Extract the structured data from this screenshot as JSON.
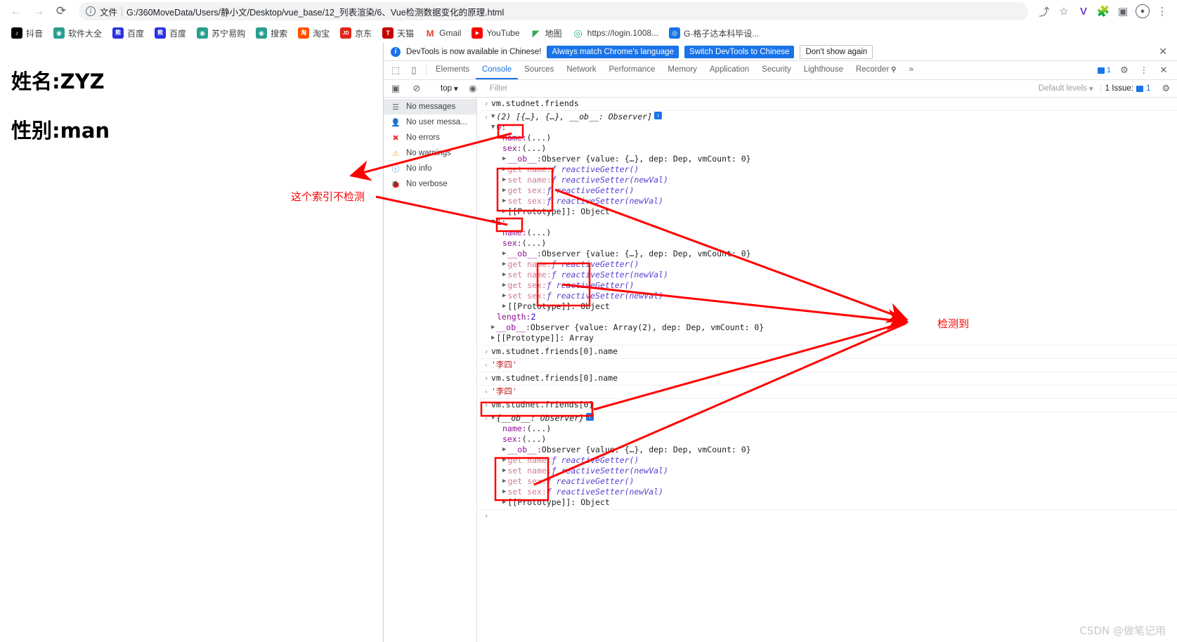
{
  "browser": {
    "nav": {
      "back": "←",
      "forward": "→",
      "reload": "⟳"
    },
    "omnibox": {
      "file_label": "文件",
      "url": "G:/360MoveData/Users/静小文/Desktop/vue_base/12_列表渲染/6、Vue检测数据变化的原理.html"
    },
    "toolbar_icons": [
      "share-icon",
      "bookmark-star-icon",
      "extension-v-icon",
      "extensions-puzzle-icon",
      "sidepanel-icon",
      "profile-avatar-icon",
      "chrome-menu-icon"
    ],
    "bookmarks": [
      {
        "label": "抖音",
        "glyph": "♪",
        "color": "#000000"
      },
      {
        "label": "软件大全",
        "glyph": "◉",
        "color": "#2a9d8f"
      },
      {
        "label": "百度",
        "glyph": "熊",
        "color": "#2932e1"
      },
      {
        "label": "百度",
        "glyph": "熊",
        "color": "#2932e1"
      },
      {
        "label": "苏宁易购",
        "glyph": "◉",
        "color": "#2a9d8f"
      },
      {
        "label": "搜索",
        "glyph": "◉",
        "color": "#2a9d8f"
      },
      {
        "label": "淘宝",
        "glyph": "淘",
        "color": "#ff5000"
      },
      {
        "label": "京东",
        "glyph": "JD",
        "color": "#e1251b"
      },
      {
        "label": "天猫",
        "glyph": "T",
        "color": "#c40000"
      },
      {
        "label": "Gmail",
        "glyph": "M",
        "color": "#ea4335"
      },
      {
        "label": "YouTube",
        "glyph": "▶",
        "color": "#ff0000"
      },
      {
        "label": "地图",
        "glyph": "◢",
        "color": "#34a853"
      },
      {
        "label": "https://login.1008...",
        "glyph": "◎",
        "color": "#2bb673"
      },
      {
        "label": "G·格子达本科毕设...",
        "glyph": "◎",
        "color": "#1a73e8"
      }
    ]
  },
  "page": {
    "line1": "姓名:ZYZ",
    "line2": "性别:man"
  },
  "devtools": {
    "banner": {
      "message": "DevTools is now available in Chinese!",
      "btn_always": "Always match Chrome's language",
      "btn_switch": "Switch DevTools to Chinese",
      "btn_dismiss": "Don't show again",
      "close": "✕"
    },
    "tabs": [
      {
        "label": "Elements",
        "active": false
      },
      {
        "label": "Console",
        "active": true
      },
      {
        "label": "Sources",
        "active": false
      },
      {
        "label": "Network",
        "active": false
      },
      {
        "label": "Performance",
        "active": false
      },
      {
        "label": "Memory",
        "active": false
      },
      {
        "label": "Application",
        "active": false
      },
      {
        "label": "Security",
        "active": false
      },
      {
        "label": "Lighthouse",
        "active": false
      },
      {
        "label": "Recorder",
        "active": false
      }
    ],
    "tabs_overflow": "»",
    "issues_count_tabbar": "1",
    "filterbar": {
      "context": "top",
      "filter_placeholder": "Filter",
      "levels": "Default levels",
      "issues_label": "1 Issue:",
      "issues_count": "1"
    },
    "sidebar": [
      {
        "label": "No messages",
        "icon": "list-icon",
        "selected": true
      },
      {
        "label": "No user messa...",
        "icon": "user-icon",
        "selected": false
      },
      {
        "label": "No errors",
        "icon": "error-icon",
        "selected": false
      },
      {
        "label": "No warnings",
        "icon": "warning-icon",
        "selected": false
      },
      {
        "label": "No info",
        "icon": "info-icon",
        "selected": false
      },
      {
        "label": "No verbose",
        "icon": "bug-icon",
        "selected": false
      }
    ],
    "console": {
      "input1": "vm.studnet.friends",
      "arr_header": "(2) [{…}, {…}, __ob__: Observer]",
      "idx0": "0:",
      "idx1": "1:",
      "name_prop": "name:",
      "sex_prop": "sex:",
      "ellipsis": "(...)",
      "ob_key": "__ob__:",
      "ob_val_obj": "Observer {value: {…}, dep: Dep, vmCount: 0}",
      "ob_val_arr": "Observer {value: Array(2), dep: Dep, vmCount: 0}",
      "get_name": "get name:",
      "set_name": "set name:",
      "get_sex": "get sex:",
      "set_sex": "set sex:",
      "reactive_getter": "ƒ reactiveGetter()",
      "reactive_setter": "ƒ reactiveSetter(newVal)",
      "proto_object": "[[Prototype]]: Object",
      "proto_array": "[[Prototype]]: Array",
      "length_key": "length:",
      "length_val": "2",
      "input2": "vm.studnet.friends[0].name",
      "output2": "'李四'",
      "input3": "vm.studnet.friends[0].name",
      "output3": "'李四'",
      "input4": "vm.studnet.friends[0]",
      "obj_header": "{__ob__: Observer}"
    }
  },
  "annotations": {
    "left_note": "这个索引不检测",
    "right_note": "检测到",
    "color": "#ff0000"
  },
  "watermark": "CSDN @做笔记用"
}
